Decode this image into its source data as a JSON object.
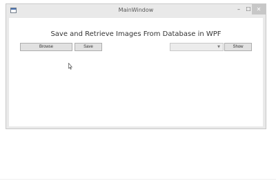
{
  "window": {
    "title": "MainWindow",
    "controls": {
      "minimize": "–",
      "maximize": "☐",
      "close": "✕"
    }
  },
  "main": {
    "heading": "Save and Retrieve Images From Database in WPF",
    "browse_label": "Browse",
    "save_label": "Save",
    "show_label": "Show",
    "combo_value": ""
  },
  "icons": {
    "app": "app-window-icon",
    "chevron": "chevron-down-icon",
    "cursor": "mouse-pointer-icon"
  },
  "colors": {
    "button_bg": "#e1e1e1",
    "window_frame": "#e9e9e9",
    "close_bg": "#c7c7c7"
  }
}
